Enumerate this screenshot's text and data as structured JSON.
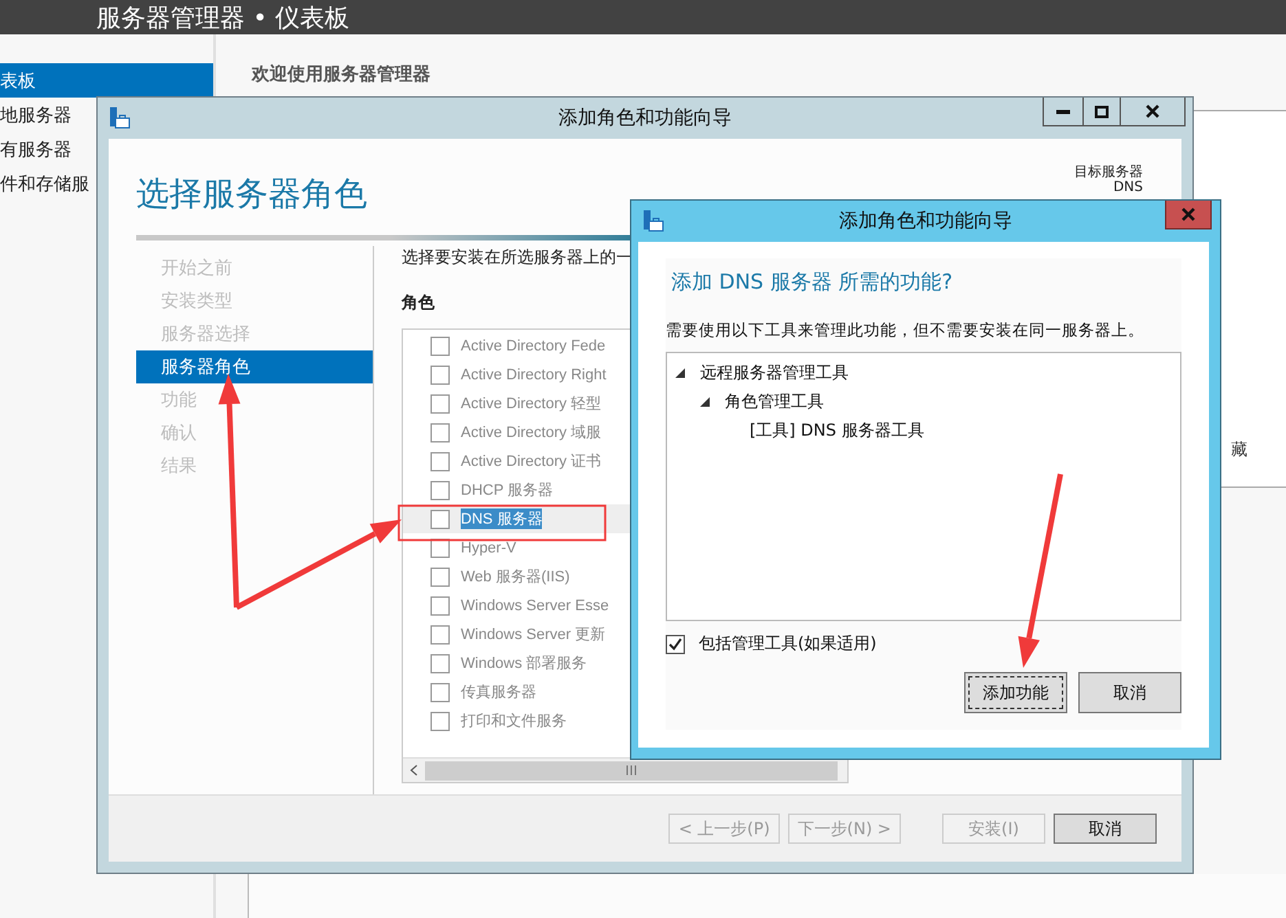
{
  "app": {
    "title": "服务器管理器 • 仪表板"
  },
  "nav": [
    {
      "label": "表板",
      "selected": true
    },
    {
      "label": "地服务器",
      "selected": false
    },
    {
      "label": "有服务器",
      "selected": false
    },
    {
      "label": "件和存储服",
      "selected": false
    }
  ],
  "welcome": "欢迎使用服务器管理器",
  "side_panel": {
    "text": "藏"
  },
  "wizard": {
    "title": "添加角色和功能向导",
    "heading": "选择服务器角色",
    "destination": {
      "label": "目标服务器",
      "server": "DNS"
    },
    "steps": [
      {
        "label": "开始之前",
        "selected": false
      },
      {
        "label": "安装类型",
        "selected": false
      },
      {
        "label": "服务器选择",
        "selected": false
      },
      {
        "label": "服务器角色",
        "selected": true
      },
      {
        "label": "功能",
        "selected": false
      },
      {
        "label": "确认",
        "selected": false
      },
      {
        "label": "结果",
        "selected": false
      }
    ],
    "instruction": "选择要安装在所选服务器上的一",
    "roles_label": "角色",
    "roles": [
      {
        "name": "Active Directory Fede",
        "checked": false,
        "selected": false
      },
      {
        "name": "Active Directory Right",
        "checked": false,
        "selected": false
      },
      {
        "name": "Active Directory 轻型",
        "checked": false,
        "selected": false
      },
      {
        "name": "Active Directory 域服",
        "checked": false,
        "selected": false
      },
      {
        "name": "Active Directory 证书",
        "checked": false,
        "selected": false
      },
      {
        "name": "DHCP 服务器",
        "checked": false,
        "selected": false
      },
      {
        "name": "DNS 服务器",
        "checked": false,
        "selected": true
      },
      {
        "name": "Hyper-V",
        "checked": false,
        "selected": false
      },
      {
        "name": "Web 服务器(IIS)",
        "checked": false,
        "selected": false
      },
      {
        "name": "Windows Server Esse",
        "checked": false,
        "selected": false
      },
      {
        "name": "Windows Server 更新",
        "checked": false,
        "selected": false
      },
      {
        "name": "Windows 部署服务",
        "checked": false,
        "selected": false
      },
      {
        "name": "传真服务器",
        "checked": false,
        "selected": false
      },
      {
        "name": "打印和文件服务",
        "checked": false,
        "selected": false
      }
    ],
    "buttons": [
      {
        "label": "< 上一步(P)",
        "disabled": true
      },
      {
        "label": "下一步(N) >",
        "disabled": true
      },
      {
        "label": "安装(I)",
        "disabled": true
      },
      {
        "label": "取消",
        "disabled": false
      }
    ]
  },
  "dialog": {
    "title": "添加角色和功能向导",
    "question": "添加 DNS 服务器 所需的功能?",
    "description": "需要使用以下工具来管理此功能，但不需要安装在同一服务器上。",
    "tree": [
      {
        "label": "远程服务器管理工具",
        "expanded": true,
        "children": [
          {
            "label": "角色管理工具",
            "expanded": true,
            "children": [
              {
                "label": "[工具] DNS 服务器工具"
              }
            ]
          }
        ]
      }
    ],
    "include_tools": {
      "label": "包括管理工具(如果适用)",
      "checked": true
    },
    "buttons": [
      {
        "label": "添加功能",
        "focused": true
      },
      {
        "label": "取消",
        "focused": false
      }
    ]
  }
}
